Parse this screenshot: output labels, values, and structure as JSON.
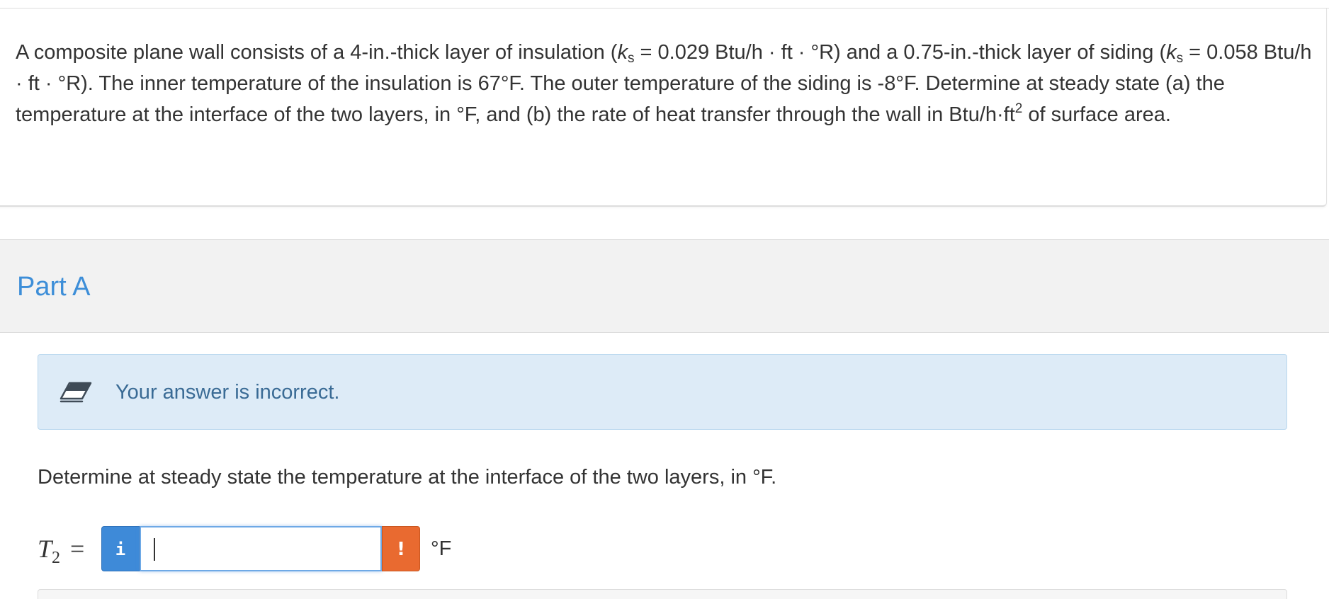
{
  "question": {
    "line1_part1": "A composite plane wall consists of a 4-in.-thick layer of insulation (",
    "k1_symbol": "k",
    "k1_sub": "s",
    "line1_part2": " = 0.029 Btu/h · ft · °R) and a 0.75-in.-thick layer of siding (",
    "k2_symbol": "k",
    "k2_sub": "s",
    "line1_part3": " = 0.058 Btu/h · ft · °R). The inner temperature of the insulation is 67°F. The outer temperature of the siding is -8°F. Determine at steady state (a) the temperature at the interface of the two layers, in °F, and (b) the rate of heat transfer through the wall in Btu/h·ft",
    "area_exp": "2",
    "line1_part4": " of surface area."
  },
  "part": {
    "title": "Part A"
  },
  "feedback": {
    "icon": "eraser-icon",
    "message": "Your answer is incorrect."
  },
  "prompt": {
    "text": "Determine at steady state the temperature at the interface of the two layers, in °F."
  },
  "answer": {
    "variable_symbol": "T",
    "variable_sub": "2",
    "equals": "=",
    "info_label": "i",
    "value": "",
    "alert_label": "!",
    "unit": "°F"
  },
  "colors": {
    "part_title": "#3d8ed8",
    "feedback_bg": "#ddebf7",
    "feedback_text": "#3a6b95",
    "info_button": "#3e8ad8",
    "alert_button": "#e96a30"
  }
}
